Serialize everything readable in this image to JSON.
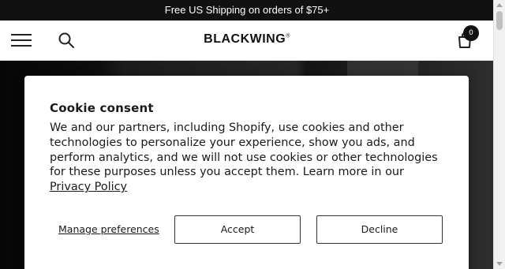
{
  "announcement": {
    "text": "Free US Shipping on orders of $75+"
  },
  "header": {
    "logo": "BLACKWING",
    "logo_mark": "®",
    "cart_count": "0"
  },
  "cookie": {
    "title": "Cookie consent",
    "body": "We and our partners, including Shopify, use cookies and other technologies to personalize your experience, show you ads, and perform analytics, and we will not use cookies or other technologies for these purposes unless you accept them. Learn more in our ",
    "privacy_link": "Privacy Policy",
    "manage_label": "Manage preferences",
    "accept_label": "Accept",
    "decline_label": "Decline"
  },
  "colors": {
    "announcement_bg": "#111111",
    "hero_bg": "#1b1b1b",
    "text": "#1a1a1a"
  }
}
